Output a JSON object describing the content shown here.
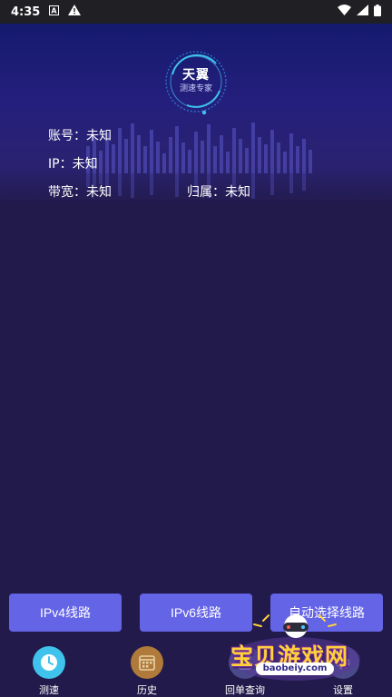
{
  "status_bar": {
    "time": "4:35"
  },
  "header": {
    "logo_title": "天翼",
    "logo_subtitle": "测速专家"
  },
  "info": {
    "account": "账号：未知",
    "ip": "IP：未知",
    "bandwidth": "带宽：未知",
    "region": "归属：未知"
  },
  "buttons": {
    "ipv4": "IPv4线路",
    "ipv6": "IPv6线路",
    "auto": "自动选择线路"
  },
  "nav": {
    "items": [
      {
        "label": "测速",
        "icon": "clock-icon",
        "color": "#3fc3ec"
      },
      {
        "label": "历史",
        "icon": "calendar-icon",
        "color": "#b07b3a"
      },
      {
        "label": "回单查询",
        "icon": "receipt-icon",
        "color": "#5a5a9a"
      },
      {
        "label": "设置",
        "icon": "gear-icon",
        "color": "#5a5a9a"
      }
    ]
  },
  "watermark": {
    "text": "宝贝游戏网",
    "url": "baobeiy.com"
  },
  "colors": {
    "background": "#221a4a",
    "button": "#6464e6",
    "accent": "#3fc3ec"
  }
}
